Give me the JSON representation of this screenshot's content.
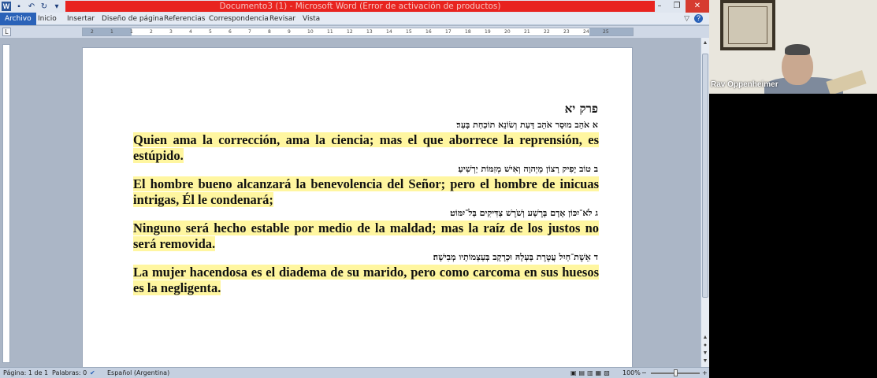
{
  "window": {
    "title": "Documento3 (1) - Microsoft Word (Error de activación de productos)",
    "controls": {
      "minimize": "–",
      "restore": "❐",
      "close": "✕"
    }
  },
  "quick_access": {
    "icons": [
      "word-icon",
      "save-icon",
      "undo-icon",
      "redo-icon",
      "customize-icon"
    ]
  },
  "tabs": [
    {
      "label": "Archivo",
      "active": true
    },
    {
      "label": "Inicio"
    },
    {
      "label": "Insertar"
    },
    {
      "label": "Diseño de página"
    },
    {
      "label": "Referencias"
    },
    {
      "label": "Correspondencia"
    },
    {
      "label": "Revisar"
    },
    {
      "label": "Vista"
    }
  ],
  "ruler": {
    "numbers": [
      "2",
      "1",
      "1",
      "2",
      "3",
      "4",
      "5",
      "6",
      "7",
      "8",
      "9",
      "10",
      "11",
      "12",
      "13",
      "14",
      "15",
      "16",
      "17",
      "18",
      "19",
      "20",
      "21",
      "22",
      "23",
      "24",
      "25"
    ]
  },
  "document": {
    "chapter_heading": "פרק יא",
    "verses": [
      {
        "hebrew": "א אֹהֵב מוּסָר אֹהֵב דָּעַת וְשׂוֹנֵא תוֹכַחַת בָּעַר׃",
        "spanish": "Quien ama la corrección, ama la ciencia; mas el que aborrece la reprensión, es estúpido."
      },
      {
        "hebrew": "ב טוֹב יָפִיק רָצוֹן מֵיְהוָה וְאִישׁ מְזִמּוֹת יַרְשִׁיעַ׃",
        "spanish": "El hombre bueno alcanzará la benevolencia del Señor; pero el hombre  de inicuas intrigas, Él le condenará;"
      },
      {
        "hebrew": "ג לֹא־יִכּוֹן אָדָם בְּרֶשַׁע וְשֹׁרֶשׁ צַדִּיקִים בַּל־יִמּוֹט׃",
        "spanish": "Ninguno será hecho estable por medio de la maldad; mas la raíz de los justos no será removida."
      },
      {
        "hebrew": "ד אֵשֶׁת־חַיִל עֲטֶרֶת בַּעְלָהּ וּכְרָקָב בְּעַצְמוֹתָיו מְבִישָׁה׃",
        "spanish": "La mujer hacendosa es el diadema de su marido, pero como carcoma en sus huesos es la negligenta."
      }
    ],
    "highlight_color": "#fff6a0"
  },
  "status_bar": {
    "page": "Página: 1 de 1",
    "words": "Palabras: 0",
    "language": "Español (Argentina)",
    "zoom": "100%",
    "zoom_out": "−",
    "zoom_in": "+"
  },
  "webcam": {
    "participant_name": "Rav Oppenheimer"
  },
  "colors": {
    "title_bar_error": "#e8231f",
    "file_tab": "#2a62b8"
  }
}
